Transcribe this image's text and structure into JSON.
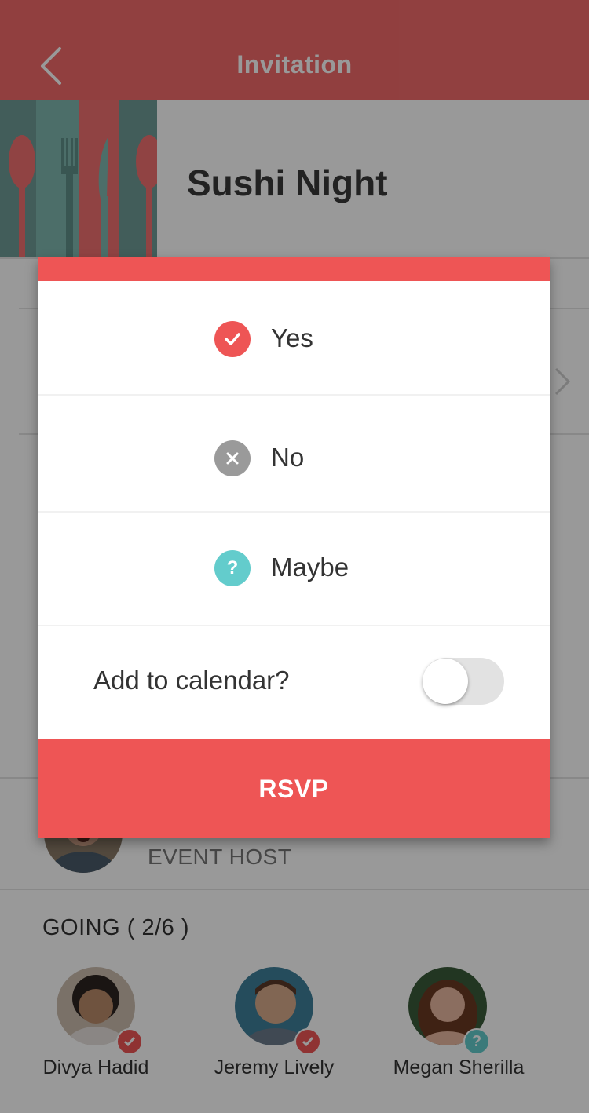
{
  "header": {
    "title": "Invitation",
    "back_icon": "chevron-left-icon"
  },
  "event": {
    "title": "Sushi Night",
    "image": "cutlery-pattern-image"
  },
  "host": {
    "label": "EVENT HOST"
  },
  "going": {
    "label": "GOING ( 2/6 )",
    "guests": [
      {
        "name": "Divya Hadid",
        "status": "yes",
        "status_icon": "check-icon"
      },
      {
        "name": "Jeremy Lively",
        "status": "yes",
        "status_icon": "check-icon"
      },
      {
        "name": "Megan Sherilla",
        "status": "maybe",
        "status_icon": "question-icon"
      }
    ]
  },
  "rsvp_dialog": {
    "options": [
      {
        "label": "Yes",
        "icon": "check-circle-icon",
        "selected": true,
        "color": "#ee5555"
      },
      {
        "label": "No",
        "icon": "x-circle-icon",
        "selected": false,
        "color": "#9a9a9a"
      },
      {
        "label": "Maybe",
        "icon": "question-circle-icon",
        "selected": false,
        "color": "#63cccc"
      }
    ],
    "calendar_label": "Add to calendar?",
    "calendar_toggle_on": false,
    "submit_label": "RSVP"
  },
  "colors": {
    "accent": "#ee5555",
    "teal": "#63cccc",
    "grey_icon": "#9a9a9a"
  }
}
